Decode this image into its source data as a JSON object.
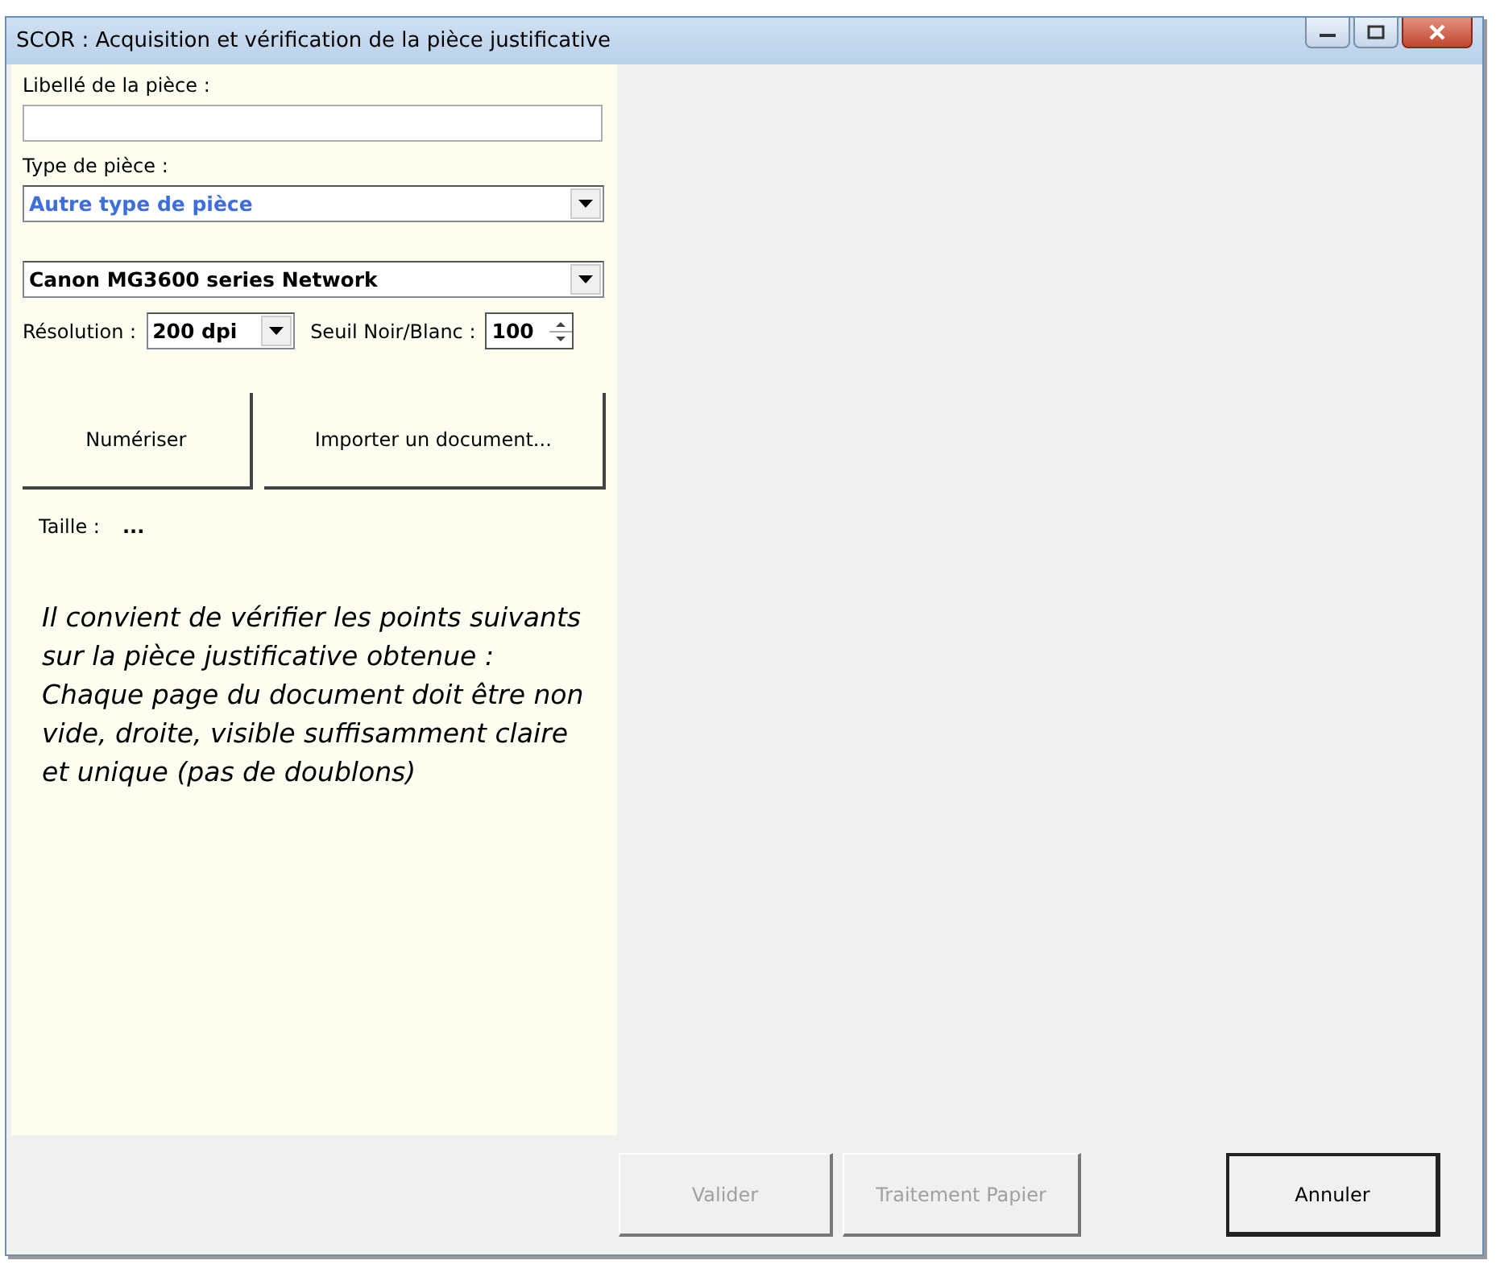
{
  "window": {
    "title": "SCOR : Acquisition et vérification de la pièce justificative"
  },
  "form": {
    "label_field": {
      "label": "Libellé de la pièce :"
    },
    "type_field": {
      "label": "Type de pièce :",
      "value": "Autre type de pièce"
    },
    "scanner": {
      "value": "Canon MG3600 series Network"
    },
    "resolution": {
      "label": "Résolution :",
      "value": "200 dpi"
    },
    "threshold": {
      "label": "Seuil  Noir/Blanc :",
      "value": "100"
    },
    "actions": [
      {
        "label": "Numériser"
      },
      {
        "label": "Importer un document..."
      }
    ],
    "size": {
      "label": "Taille :",
      "value": "..."
    },
    "instructions": [
      "Il convient de vérifier les points suivants sur la pièce justificative obtenue :",
      "Chaque page du document doit être non vide, droite, visible suffisamment claire et unique (pas de doublons)"
    ]
  },
  "buttons": [
    {
      "label": "Valider",
      "disabled": true,
      "default": false
    },
    {
      "label": "Traitement Papier",
      "disabled": true,
      "default": false
    },
    {
      "label": "Annuler",
      "disabled": false,
      "default": true
    }
  ]
}
